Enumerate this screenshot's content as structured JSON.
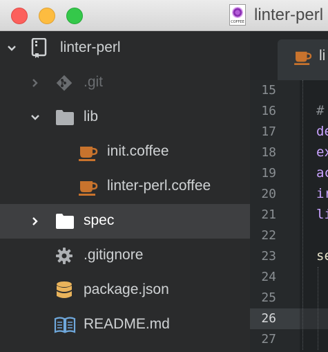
{
  "window": {
    "title": "linter-perl",
    "doc_icon_label": "COFFEE"
  },
  "tree": [
    {
      "label": "linter-perl",
      "icon": "repo-icon",
      "expanded": true
    },
    {
      "label": ".git",
      "icon": "git-icon",
      "expanded": false
    },
    {
      "label": "lib",
      "icon": "folder-icon",
      "expanded": true
    },
    {
      "label": "init.coffee",
      "icon": "coffee-icon"
    },
    {
      "label": "linter-perl.coffee",
      "icon": "coffee-icon"
    },
    {
      "label": "spec",
      "icon": "folder-icon",
      "expanded": false,
      "selected": true
    },
    {
      "label": ".gitignore",
      "icon": "gear-icon"
    },
    {
      "label": "package.json",
      "icon": "database-icon"
    },
    {
      "label": "README.md",
      "icon": "book-icon"
    }
  ],
  "editor": {
    "tab_label": "li",
    "line_numbers": [
      "15",
      "16",
      "17",
      "18",
      "19",
      "20",
      "21",
      "22",
      "23",
      "24",
      "25",
      "26",
      "27"
    ],
    "active_line": "26",
    "code_fragments": [
      "",
      "#",
      "de",
      "ex",
      "ac",
      "ir",
      "li",
      "",
      "se",
      "",
      "",
      "",
      ""
    ]
  },
  "colors": {
    "coffee": "#c8732d",
    "folder": "#e8e8e8",
    "json": "#e9b35b",
    "readme": "#6fa8dc",
    "code_keyword": "#c8a2ff",
    "code_text": "#e6e2c9"
  }
}
